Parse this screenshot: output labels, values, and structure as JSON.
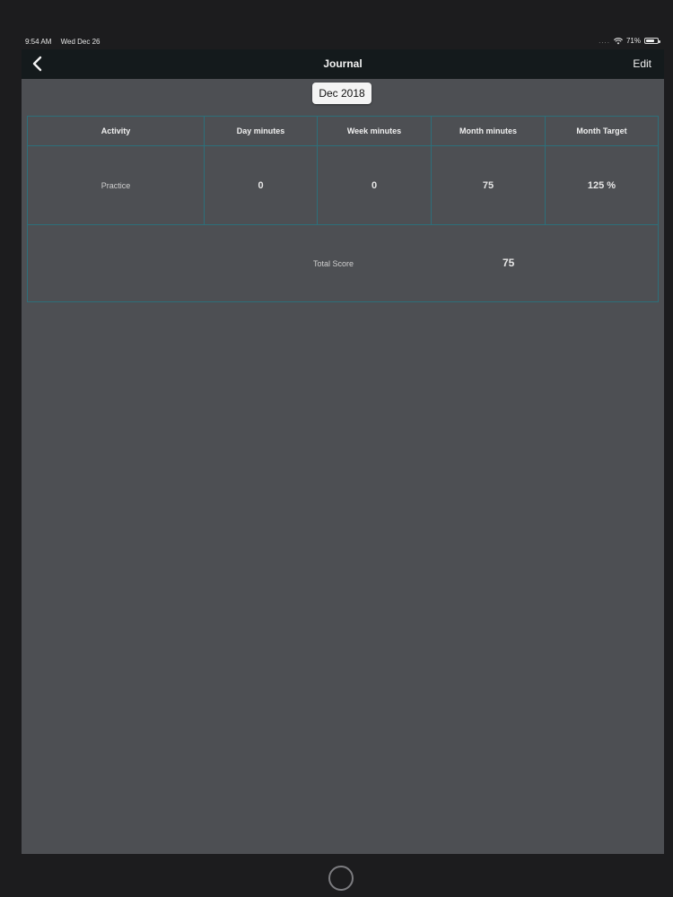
{
  "status": {
    "time": "9:54 AM",
    "date": "Wed Dec 26",
    "signal": "....",
    "battery_text": "71%",
    "battery_level": 0.71
  },
  "navbar": {
    "title": "Journal",
    "back_icon": "chevron-left-icon",
    "edit_label": "Edit"
  },
  "picker": {
    "month": "Dec 2018"
  },
  "table": {
    "headers": [
      "Activity",
      "Day minutes",
      "Week minutes",
      "Month minutes",
      "Month Target"
    ],
    "rows": [
      [
        "Practice",
        "0",
        "0",
        "75",
        "125 %"
      ]
    ],
    "total_label": "Total Score",
    "total_value": "75"
  },
  "colors": {
    "content_bg": "#4d4f53",
    "grid_line": "#2d6f7a",
    "navbar_bg": "#141a1c"
  }
}
